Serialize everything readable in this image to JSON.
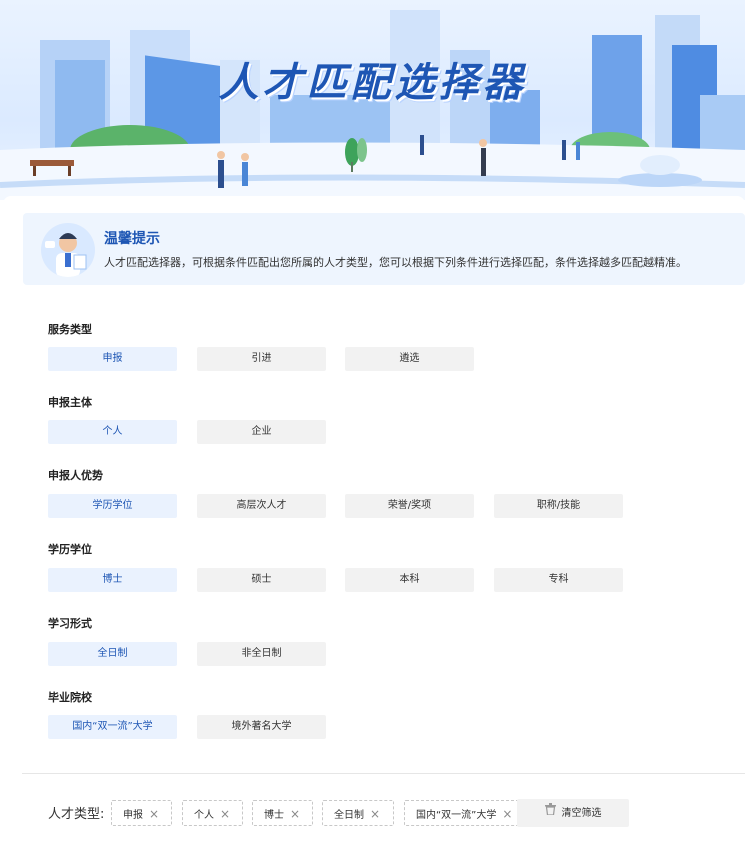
{
  "header": {
    "title": "人才匹配选择器"
  },
  "tips": {
    "title": "温馨提示",
    "text": "人才匹配选择器，可根据条件匹配出您所属的人才类型，您可以根据下列条件进行选择匹配，条件选择越多匹配越精准。"
  },
  "filters": [
    {
      "label": "服务类型",
      "options": [
        "申报",
        "引进",
        "遴选"
      ],
      "selected": 0
    },
    {
      "label": "申报主体",
      "options": [
        "个人",
        "企业"
      ],
      "selected": 0
    },
    {
      "label": "申报人优势",
      "options": [
        "学历学位",
        "高层次人才",
        "荣誉/奖项",
        "职称/技能"
      ],
      "selected": 0
    },
    {
      "label": "学历学位",
      "options": [
        "博士",
        "硕士",
        "本科",
        "专科"
      ],
      "selected": 0
    },
    {
      "label": "学习形式",
      "options": [
        "全日制",
        "非全日制"
      ],
      "selected": 0
    },
    {
      "label": "毕业院校",
      "options": [
        "国内“双一流”大学",
        "境外著名大学"
      ],
      "selected": 0
    }
  ],
  "result": {
    "label": "人才类型:",
    "tags": [
      "申报",
      "个人",
      "博士",
      "全日制",
      "国内“双一流”大学"
    ],
    "remove_symbol": "×",
    "clear_label": "清空筛选"
  },
  "colors": {
    "accent": "#1e56b4",
    "selected_bg": "#eaf2fe",
    "option_bg": "#f2f2f2"
  }
}
